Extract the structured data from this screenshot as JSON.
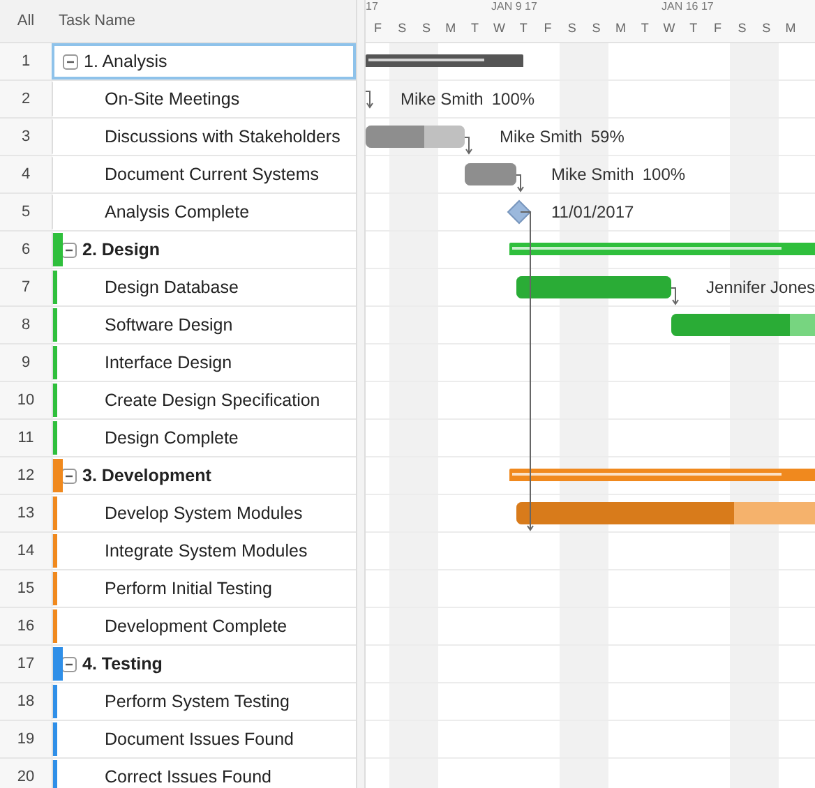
{
  "header": {
    "all": "All",
    "task_name": "Task Name",
    "months": [
      "17",
      "JAN 9 17",
      "JAN 16 17"
    ],
    "days": [
      "F",
      "S",
      "S",
      "M",
      "T",
      "W",
      "T",
      "F",
      "S",
      "S",
      "M",
      "T",
      "W",
      "T",
      "F",
      "S",
      "S",
      "M"
    ]
  },
  "groups": [
    {
      "number": "1",
      "name": "1. Analysis",
      "bold": false,
      "expanded": true,
      "selected": true,
      "gantt": {
        "kind": "summary"
      },
      "children": [
        {
          "number": "2",
          "name": "On-Site Meetings",
          "selected": false,
          "gantt": {
            "kind": "offscreen",
            "resource": "Mike Smith",
            "percent": "100%"
          }
        },
        {
          "number": "3",
          "name": "Discussions with Stakeholders",
          "selected": false,
          "gantt": {
            "kind": "task",
            "level": 0.59,
            "resource": "Mike Smith",
            "percent": "59%"
          }
        },
        {
          "number": "4",
          "name": "Document Current Systems",
          "selected": false,
          "gantt": {
            "kind": "task",
            "level": 1,
            "resource": "Mike Smith",
            "percent": "100%"
          }
        },
        {
          "number": "5",
          "name": "Analysis Complete",
          "selected": false,
          "gantt": {
            "kind": "milestone",
            "date": "11/01/2017"
          }
        }
      ]
    },
    {
      "number": "6",
      "name": "2. Design",
      "bold": true,
      "expanded": true,
      "selected": false,
      "color": "#2fbf3c",
      "gantt": {
        "kind": "summary"
      },
      "children": [
        {
          "number": "7",
          "name": "Design Database",
          "selected": false,
          "gantt": {
            "kind": "task",
            "level": 1,
            "resource": "Jennifer Jones"
          }
        },
        {
          "number": "8",
          "name": "Software Design",
          "selected": false,
          "gantt": {
            "kind": "task",
            "level": 0.65
          }
        },
        {
          "number": "9",
          "name": "Interface Design",
          "selected": false
        },
        {
          "number": "10",
          "name": "Create Design Specification",
          "selected": false
        },
        {
          "number": "11",
          "name": "Design Complete",
          "selected": false
        }
      ]
    },
    {
      "number": "12",
      "name": "3. Development",
      "bold": true,
      "expanded": true,
      "selected": false,
      "color": "#f0891e",
      "gantt": {
        "kind": "summary"
      },
      "children": [
        {
          "number": "13",
          "name": "Develop System Modules",
          "selected": false,
          "gantt": {
            "kind": "task",
            "level": 0.65
          }
        },
        {
          "number": "14",
          "name": "Integrate System Modules",
          "selected": false
        },
        {
          "number": "15",
          "name": "Perform Initial Testing",
          "selected": false
        },
        {
          "number": "16",
          "name": "Development Complete",
          "selected": false
        }
      ]
    },
    {
      "number": "17",
      "name": "4. Testing",
      "bold": true,
      "expanded": true,
      "selected": false,
      "color": "#2f8fe8",
      "children": [
        {
          "number": "18",
          "name": "Perform System Testing",
          "selected": false
        },
        {
          "number": "19",
          "name": "Document Issues Found",
          "selected": false
        },
        {
          "number": "20",
          "name": "Correct Issues Found",
          "selected": false
        }
      ]
    }
  ]
}
